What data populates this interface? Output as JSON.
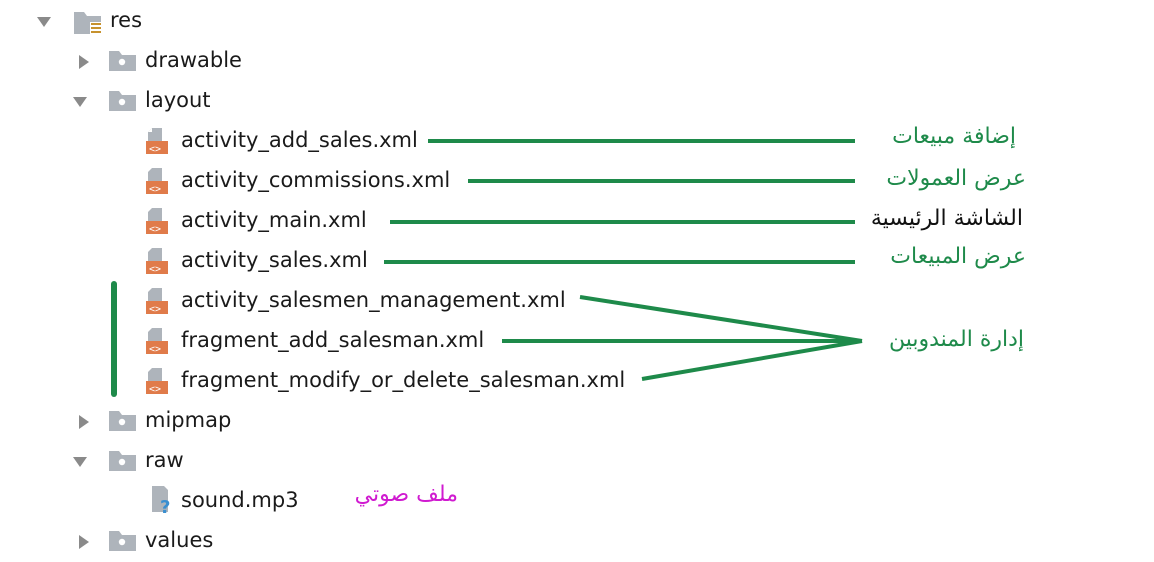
{
  "colors": {
    "annotation_green": "#1e8a4a",
    "annotation_black": "#111111",
    "annotation_magenta": "#d01ad0",
    "folder": "#aeb4bb",
    "xml_orange": "#e07b4a"
  },
  "tree": {
    "res": {
      "label": "res",
      "icon": "resources-folder-icon"
    },
    "drawable": {
      "label": "drawable",
      "icon": "folder-icon"
    },
    "layout": {
      "label": "layout",
      "icon": "folder-icon"
    },
    "files": [
      {
        "label": "activity_add_sales.xml",
        "icon": "xml-file-icon"
      },
      {
        "label": "activity_commissions.xml",
        "icon": "xml-file-icon"
      },
      {
        "label": "activity_main.xml",
        "icon": "xml-file-icon"
      },
      {
        "label": "activity_sales.xml",
        "icon": "xml-file-icon"
      },
      {
        "label": "activity_salesmen_management.xml",
        "icon": "xml-file-icon"
      },
      {
        "label": "fragment_add_salesman.xml",
        "icon": "xml-file-icon"
      },
      {
        "label": "fragment_modify_or_delete_salesman.xml",
        "icon": "xml-file-icon"
      }
    ],
    "mipmap": {
      "label": "mipmap",
      "icon": "folder-icon"
    },
    "raw": {
      "label": "raw",
      "icon": "folder-icon"
    },
    "sound": {
      "label": "sound.mp3",
      "icon": "unknown-file-icon"
    },
    "values": {
      "label": "values",
      "icon": "folder-icon"
    }
  },
  "annotations": {
    "add_sales": "إضافة مبيعات",
    "commissions": "عرض العمولات",
    "main": "الشاشة الرئيسية",
    "sales": "عرض المبيعات",
    "salesmen": "إدارة المندوبين",
    "sound": "ملف صوتي"
  }
}
